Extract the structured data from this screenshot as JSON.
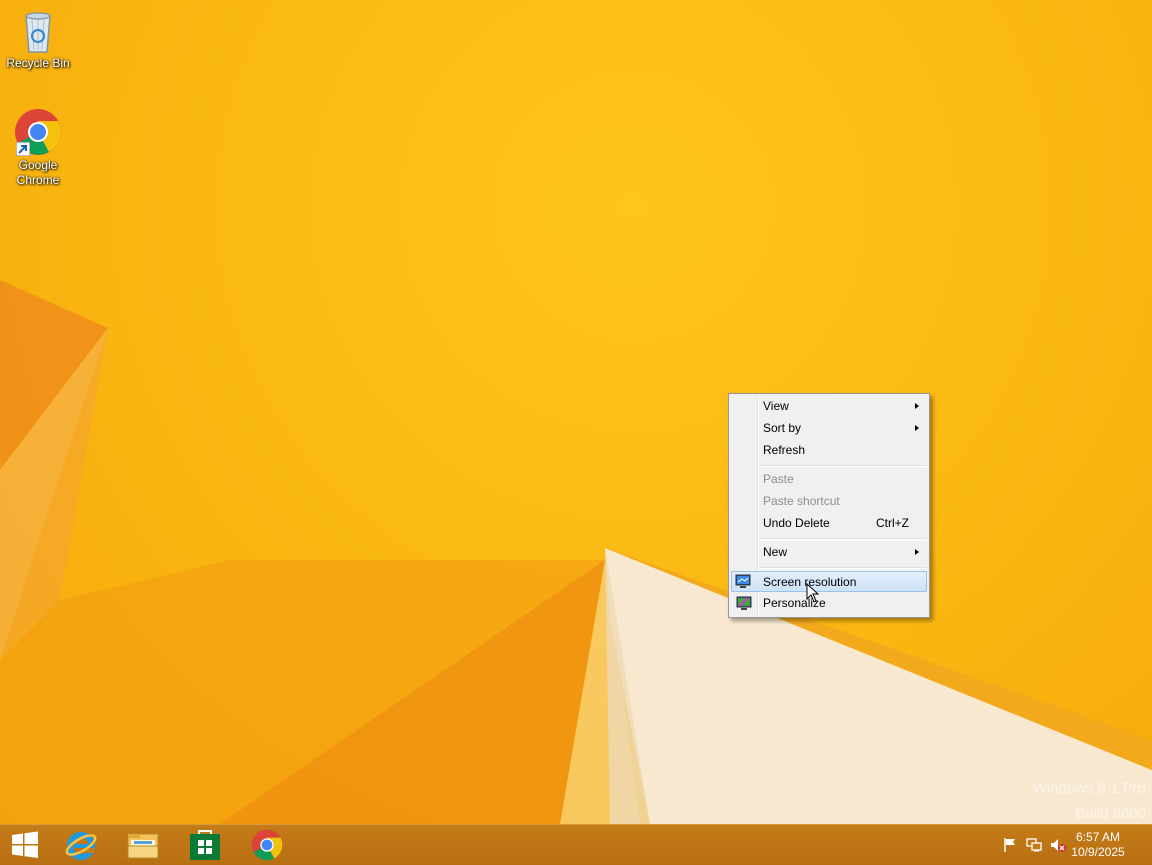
{
  "desktop": {
    "icons": [
      {
        "label": "Recycle Bin",
        "icon": "recycle-bin-icon"
      },
      {
        "label": "Google Chrome",
        "icon": "chrome-icon"
      }
    ],
    "watermark": {
      "line1": "Windows 8.1 Pro",
      "line2": "Build 9600"
    }
  },
  "context_menu": {
    "items": [
      {
        "label": "View",
        "submenu": true,
        "enabled": true
      },
      {
        "label": "Sort by",
        "submenu": true,
        "enabled": true
      },
      {
        "label": "Refresh",
        "enabled": true
      },
      {
        "label": "Paste",
        "enabled": false
      },
      {
        "label": "Paste shortcut",
        "enabled": false
      },
      {
        "label": "Undo Delete",
        "shortcut": "Ctrl+Z",
        "enabled": true
      },
      {
        "label": "New",
        "submenu": true,
        "enabled": true
      },
      {
        "label": "Screen resolution",
        "icon": "display-icon",
        "enabled": true,
        "highlighted": true
      },
      {
        "label": "Personalize",
        "icon": "personalize-icon",
        "enabled": true
      }
    ]
  },
  "taskbar": {
    "pinned": [
      {
        "name": "Start",
        "icon": "windows-start-icon"
      },
      {
        "name": "Internet Explorer",
        "icon": "internet-explorer-icon"
      },
      {
        "name": "File Explorer",
        "icon": "file-explorer-icon"
      },
      {
        "name": "Store",
        "icon": "store-icon"
      },
      {
        "name": "Google Chrome",
        "icon": "chrome-icon"
      }
    ],
    "tray": [
      "action-center-flag-icon",
      "network-icon",
      "volume-muted-icon"
    ],
    "clock": {
      "time": "6:57 AM",
      "date": "10/9/2025"
    }
  },
  "colors": {
    "wallpaper": "#f7b90a",
    "taskbar": "#c47b18",
    "menu_highlight": "#cfe2f7"
  }
}
